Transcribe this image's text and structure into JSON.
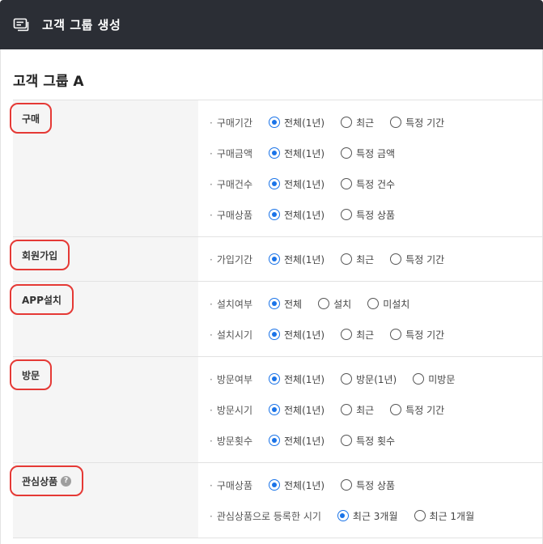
{
  "header": {
    "title": "고객 그룹 생성",
    "icon": "message-card-icon",
    "bg": "#2b2e35"
  },
  "group_title": "고객 그룹 A",
  "accent": "#1a73e8",
  "highlight": "#e53935",
  "sections": [
    {
      "label": "구매",
      "rows": [
        {
          "label": "구매기간",
          "options": [
            "전체(1년)",
            "최근",
            "특정 기간"
          ],
          "selected": 0
        },
        {
          "label": "구매금액",
          "options": [
            "전체(1년)",
            "특정 금액"
          ],
          "selected": 0
        },
        {
          "label": "구매건수",
          "options": [
            "전체(1년)",
            "특정 건수"
          ],
          "selected": 0
        },
        {
          "label": "구매상품",
          "options": [
            "전체(1년)",
            "특정 상품"
          ],
          "selected": 0
        }
      ]
    },
    {
      "label": "회원가입",
      "rows": [
        {
          "label": "가입기간",
          "options": [
            "전체(1년)",
            "최근",
            "특정 기간"
          ],
          "selected": 0
        }
      ]
    },
    {
      "label": "APP설치",
      "rows": [
        {
          "label": "설치여부",
          "options": [
            "전체",
            "설치",
            "미설치"
          ],
          "selected": 0
        },
        {
          "label": "설치시기",
          "options": [
            "전체(1년)",
            "최근",
            "특정 기간"
          ],
          "selected": 0
        }
      ]
    },
    {
      "label": "방문",
      "rows": [
        {
          "label": "방문여부",
          "options": [
            "전체(1년)",
            "방문(1년)",
            "미방문"
          ],
          "selected": 0
        },
        {
          "label": "방문시기",
          "options": [
            "전체(1년)",
            "최근",
            "특정 기간"
          ],
          "selected": 0
        },
        {
          "label": "방문횟수",
          "options": [
            "전체(1년)",
            "특정 횟수"
          ],
          "selected": 0
        }
      ]
    },
    {
      "label": "관심상품",
      "help": "?",
      "rows": [
        {
          "label": "구매상품",
          "options": [
            "전체(1년)",
            "특정 상품"
          ],
          "selected": 0
        },
        {
          "label": "관심상품으로 등록한 시기",
          "options": [
            "최근 3개월",
            "최근 1개월"
          ],
          "selected": 0
        }
      ]
    }
  ]
}
